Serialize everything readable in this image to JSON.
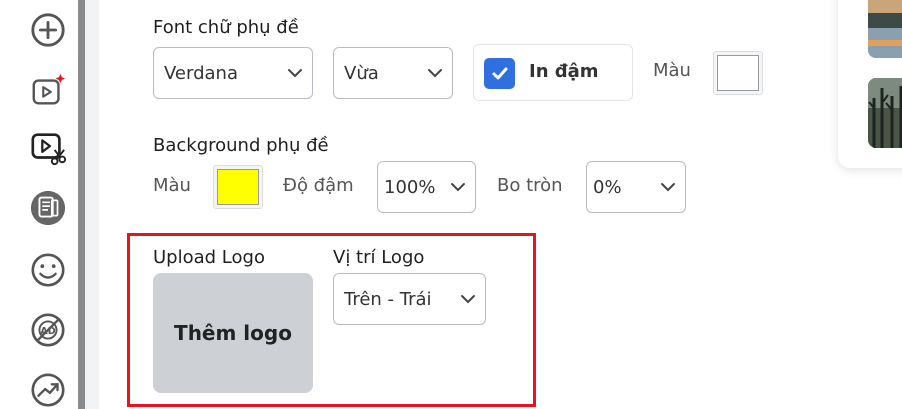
{
  "sidebar": {
    "items": [
      {
        "icon": "add-circle-icon"
      },
      {
        "icon": "ai-video-icon"
      },
      {
        "icon": "video-cut-icon"
      },
      {
        "icon": "document-icon"
      },
      {
        "icon": "smiley-icon"
      },
      {
        "icon": "ad-block-icon"
      },
      {
        "icon": "trending-icon"
      }
    ]
  },
  "subtitle_font": {
    "label": "Font chữ phụ đề",
    "font_value": "Verdana",
    "size_value": "Vừa",
    "bold_label": "In đậm",
    "bold_checked": true,
    "color_label": "Màu",
    "color": "#ffffff"
  },
  "subtitle_background": {
    "label": "Background phụ đề",
    "color_label": "Màu",
    "color": "#ffff00",
    "opacity_label": "Độ đậm",
    "opacity_value": "100%",
    "radius_label": "Bo tròn",
    "radius_value": "0%"
  },
  "logo": {
    "upload_label": "Upload Logo",
    "upload_button": "Thêm logo",
    "position_label": "Vị trí Logo",
    "position_value": "Trên - Trái"
  },
  "colors": {
    "accent": "#2f6fe0",
    "highlight": "#e8141b"
  }
}
